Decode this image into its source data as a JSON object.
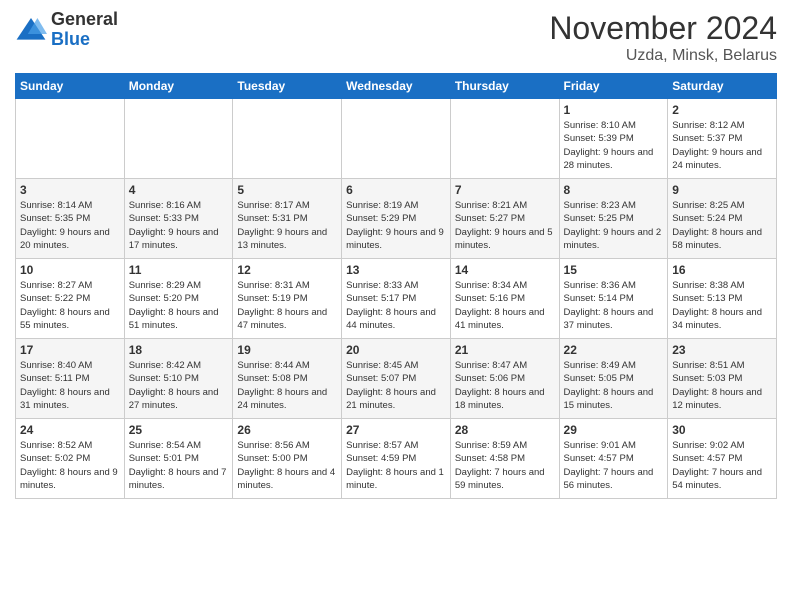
{
  "header": {
    "logo_general": "General",
    "logo_blue": "Blue",
    "month_title": "November 2024",
    "location": "Uzda, Minsk, Belarus"
  },
  "days_of_week": [
    "Sunday",
    "Monday",
    "Tuesday",
    "Wednesday",
    "Thursday",
    "Friday",
    "Saturday"
  ],
  "weeks": [
    [
      {
        "day": "",
        "info": ""
      },
      {
        "day": "",
        "info": ""
      },
      {
        "day": "",
        "info": ""
      },
      {
        "day": "",
        "info": ""
      },
      {
        "day": "",
        "info": ""
      },
      {
        "day": "1",
        "info": "Sunrise: 8:10 AM\nSunset: 5:39 PM\nDaylight: 9 hours and 28 minutes."
      },
      {
        "day": "2",
        "info": "Sunrise: 8:12 AM\nSunset: 5:37 PM\nDaylight: 9 hours and 24 minutes."
      }
    ],
    [
      {
        "day": "3",
        "info": "Sunrise: 8:14 AM\nSunset: 5:35 PM\nDaylight: 9 hours and 20 minutes."
      },
      {
        "day": "4",
        "info": "Sunrise: 8:16 AM\nSunset: 5:33 PM\nDaylight: 9 hours and 17 minutes."
      },
      {
        "day": "5",
        "info": "Sunrise: 8:17 AM\nSunset: 5:31 PM\nDaylight: 9 hours and 13 minutes."
      },
      {
        "day": "6",
        "info": "Sunrise: 8:19 AM\nSunset: 5:29 PM\nDaylight: 9 hours and 9 minutes."
      },
      {
        "day": "7",
        "info": "Sunrise: 8:21 AM\nSunset: 5:27 PM\nDaylight: 9 hours and 5 minutes."
      },
      {
        "day": "8",
        "info": "Sunrise: 8:23 AM\nSunset: 5:25 PM\nDaylight: 9 hours and 2 minutes."
      },
      {
        "day": "9",
        "info": "Sunrise: 8:25 AM\nSunset: 5:24 PM\nDaylight: 8 hours and 58 minutes."
      }
    ],
    [
      {
        "day": "10",
        "info": "Sunrise: 8:27 AM\nSunset: 5:22 PM\nDaylight: 8 hours and 55 minutes."
      },
      {
        "day": "11",
        "info": "Sunrise: 8:29 AM\nSunset: 5:20 PM\nDaylight: 8 hours and 51 minutes."
      },
      {
        "day": "12",
        "info": "Sunrise: 8:31 AM\nSunset: 5:19 PM\nDaylight: 8 hours and 47 minutes."
      },
      {
        "day": "13",
        "info": "Sunrise: 8:33 AM\nSunset: 5:17 PM\nDaylight: 8 hours and 44 minutes."
      },
      {
        "day": "14",
        "info": "Sunrise: 8:34 AM\nSunset: 5:16 PM\nDaylight: 8 hours and 41 minutes."
      },
      {
        "day": "15",
        "info": "Sunrise: 8:36 AM\nSunset: 5:14 PM\nDaylight: 8 hours and 37 minutes."
      },
      {
        "day": "16",
        "info": "Sunrise: 8:38 AM\nSunset: 5:13 PM\nDaylight: 8 hours and 34 minutes."
      }
    ],
    [
      {
        "day": "17",
        "info": "Sunrise: 8:40 AM\nSunset: 5:11 PM\nDaylight: 8 hours and 31 minutes."
      },
      {
        "day": "18",
        "info": "Sunrise: 8:42 AM\nSunset: 5:10 PM\nDaylight: 8 hours and 27 minutes."
      },
      {
        "day": "19",
        "info": "Sunrise: 8:44 AM\nSunset: 5:08 PM\nDaylight: 8 hours and 24 minutes."
      },
      {
        "day": "20",
        "info": "Sunrise: 8:45 AM\nSunset: 5:07 PM\nDaylight: 8 hours and 21 minutes."
      },
      {
        "day": "21",
        "info": "Sunrise: 8:47 AM\nSunset: 5:06 PM\nDaylight: 8 hours and 18 minutes."
      },
      {
        "day": "22",
        "info": "Sunrise: 8:49 AM\nSunset: 5:05 PM\nDaylight: 8 hours and 15 minutes."
      },
      {
        "day": "23",
        "info": "Sunrise: 8:51 AM\nSunset: 5:03 PM\nDaylight: 8 hours and 12 minutes."
      }
    ],
    [
      {
        "day": "24",
        "info": "Sunrise: 8:52 AM\nSunset: 5:02 PM\nDaylight: 8 hours and 9 minutes."
      },
      {
        "day": "25",
        "info": "Sunrise: 8:54 AM\nSunset: 5:01 PM\nDaylight: 8 hours and 7 minutes."
      },
      {
        "day": "26",
        "info": "Sunrise: 8:56 AM\nSunset: 5:00 PM\nDaylight: 8 hours and 4 minutes."
      },
      {
        "day": "27",
        "info": "Sunrise: 8:57 AM\nSunset: 4:59 PM\nDaylight: 8 hours and 1 minute."
      },
      {
        "day": "28",
        "info": "Sunrise: 8:59 AM\nSunset: 4:58 PM\nDaylight: 7 hours and 59 minutes."
      },
      {
        "day": "29",
        "info": "Sunrise: 9:01 AM\nSunset: 4:57 PM\nDaylight: 7 hours and 56 minutes."
      },
      {
        "day": "30",
        "info": "Sunrise: 9:02 AM\nSunset: 4:57 PM\nDaylight: 7 hours and 54 minutes."
      }
    ]
  ]
}
